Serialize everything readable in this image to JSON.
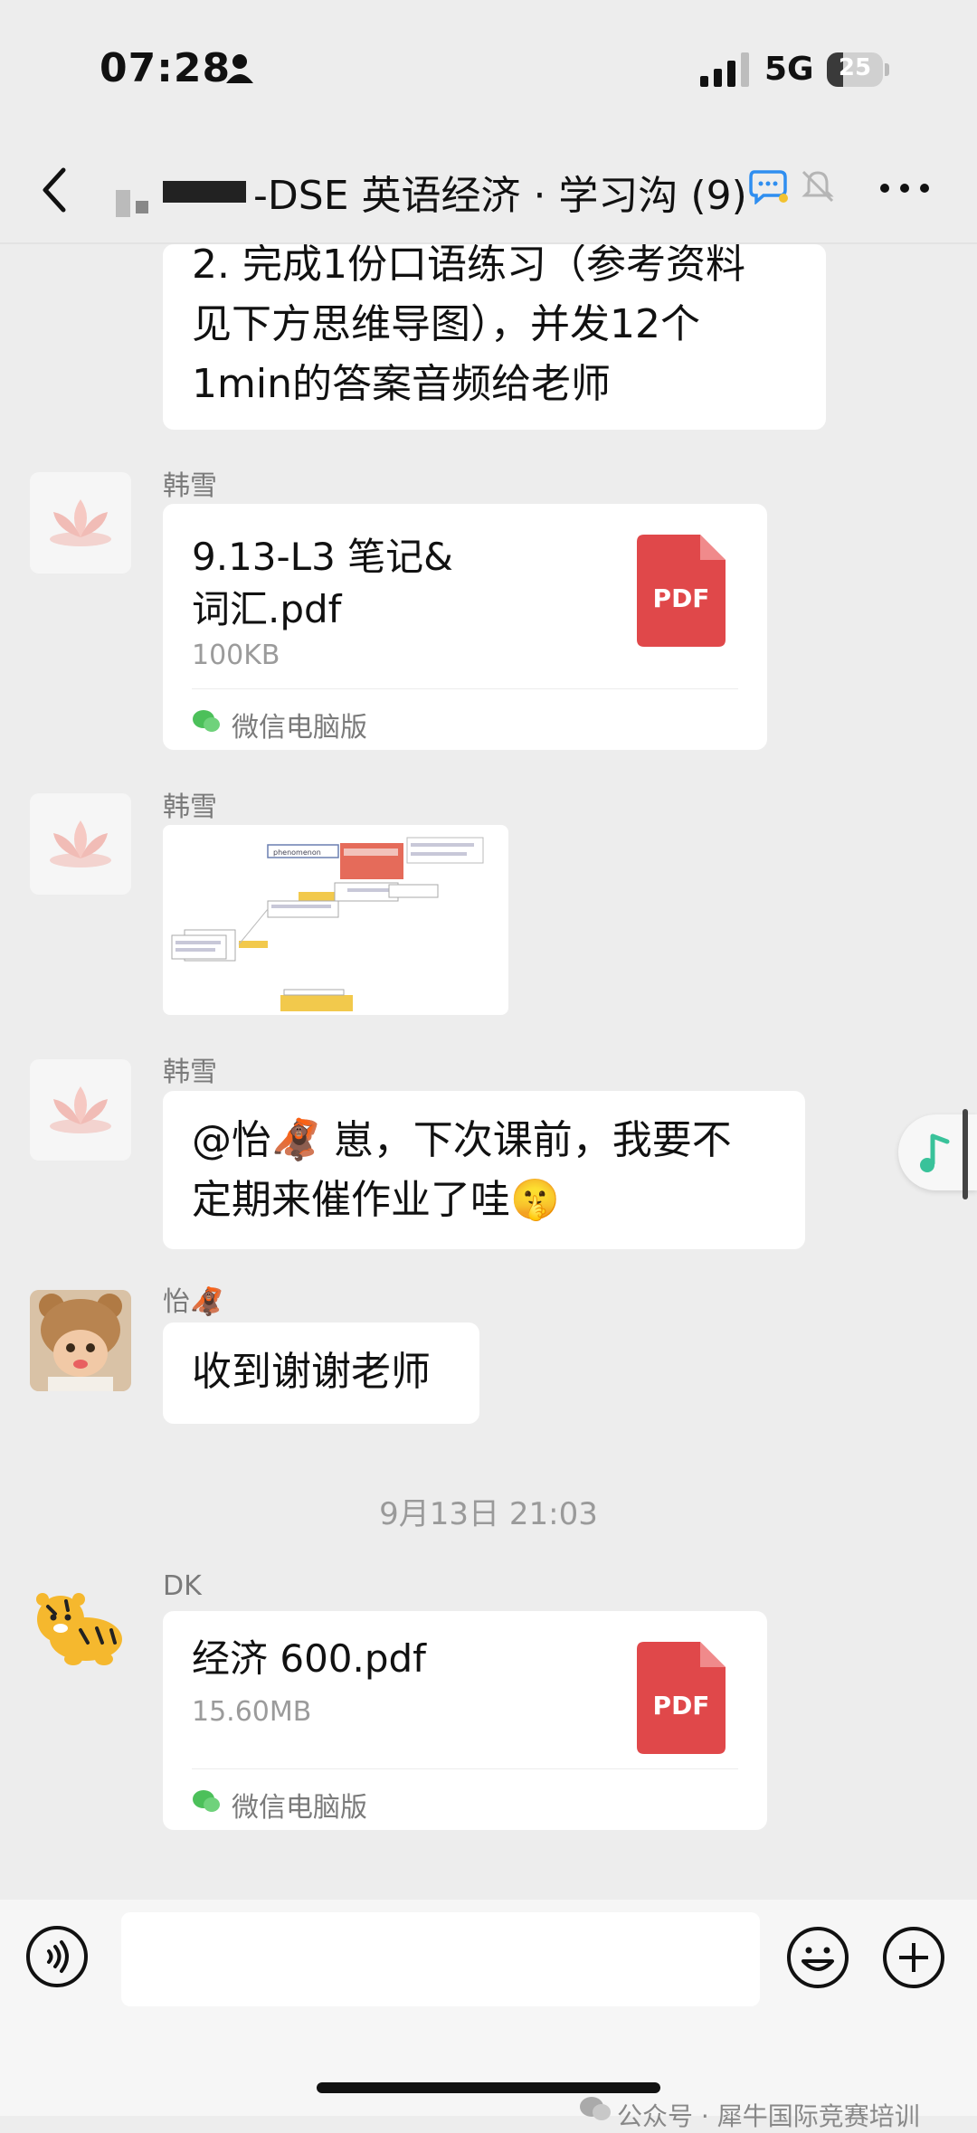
{
  "status_bar": {
    "time": "07:28",
    "network": "5G",
    "battery": "25"
  },
  "header": {
    "title": "-DSE 英语经济 · 学习沟 (9)"
  },
  "messages": {
    "m0": {
      "lines": [
        "2. 完成1份口语练习（参考资料",
        "见下方思维导图），并发12个",
        "1min的答案音频给老师"
      ]
    },
    "m1": {
      "sender": "韩雪",
      "file_name_line1": "9.13-L3 笔记&",
      "file_name_line2": "词汇.pdf",
      "file_size": "100KB",
      "file_icon_label": "PDF",
      "source": "微信电脑版"
    },
    "m2": {
      "sender": "韩雪"
    },
    "m3": {
      "sender": "韩雪",
      "line1": "@怡🦧 崽，下次课前，我要不",
      "line2": "定期来催作业了哇🤫"
    },
    "m4": {
      "sender": "怡🦧",
      "text": "收到谢谢老师"
    },
    "timestamp": "9月13日 21:03",
    "m5": {
      "sender": "DK",
      "file_name": "经济 600.pdf",
      "file_size": "15.60MB",
      "file_icon_label": "PDF",
      "source": "微信电脑版"
    }
  },
  "mindmap": {
    "node_label": "phenomenon"
  },
  "watermark": "公众号 · 犀牛国际竞赛培训"
}
